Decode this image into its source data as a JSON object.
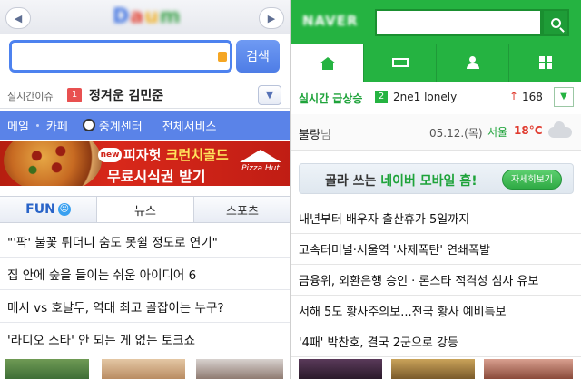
{
  "daum": {
    "logo_letters": [
      "D",
      "a",
      "u",
      "m"
    ],
    "search": {
      "value": "",
      "button_label": "검색"
    },
    "issue": {
      "label": "실시간이슈",
      "rank": "1",
      "text": "정겨운 김민준"
    },
    "menu": [
      "메일",
      "카페",
      "중계센터",
      "전체서비스"
    ],
    "banner": {
      "badge": "new",
      "line1_prefix": "피자헛 ",
      "line1_highlight": "크런치골드",
      "line2": "무료시식권 받기",
      "brand": "Pizza Hut"
    },
    "tabs": [
      {
        "label": "FUN",
        "icon": "smile-icon"
      },
      {
        "label": "뉴스"
      },
      {
        "label": "스포츠"
      }
    ],
    "news": [
      "\"'팍' 불꽃 튀더니 숨도 못쉴 정도로 연기\"",
      "집 안에 숲을 들이는 쉬운 아이디어 6",
      "메시 vs 호날두, 역대 최고 골잡이는 누구?",
      "'라디오 스타' 안 되는 게 없는 토크쇼"
    ]
  },
  "naver": {
    "logo": "NAVER",
    "search": {
      "value": ""
    },
    "tabs": [
      "home-icon",
      "rect-icon",
      "user-icon",
      "grid-icon"
    ],
    "trend": {
      "label": "실시간 급상승",
      "rank": "2",
      "text": "2ne1 lonely",
      "arrow": "↑",
      "count": "168"
    },
    "weather": {
      "user": "불량",
      "user_suffix": "님",
      "date": "05.12.(목)",
      "city": "서울",
      "temp": "18°C",
      "icon": "cloud-icon"
    },
    "banner": {
      "prefix": "골라 쓰는 ",
      "highlight": "네이버 모바일 홈!",
      "button_label": "자세히보기"
    },
    "news": [
      "내년부터 배우자 출산휴가 5일까지",
      "고속터미널·서울역 '사제폭탄' 연쇄폭발",
      "금융위, 외환은행 승인 · 론스타 적격성 심사 유보",
      "서해 5도 황사주의보...전국 황사 예비특보",
      "'4패' 박찬호, 결국 2군으로 강등"
    ]
  },
  "colors": {
    "daum_blue": "#5a83e8",
    "naver_green": "#25b341",
    "rank_red": "#e85050"
  }
}
